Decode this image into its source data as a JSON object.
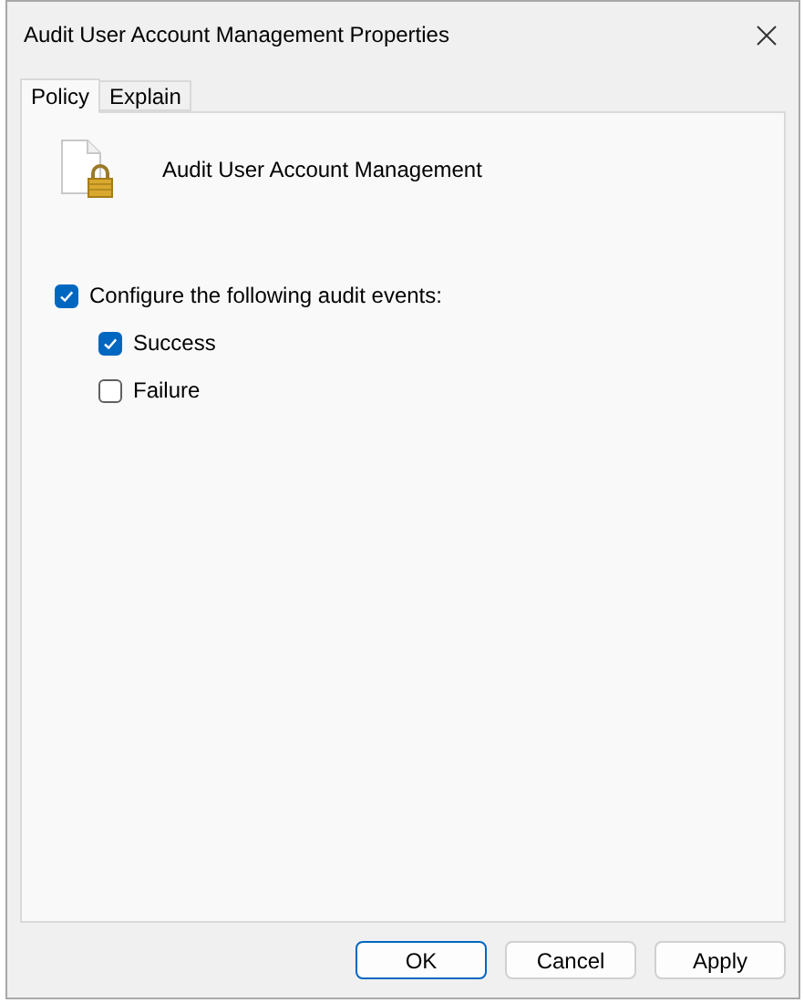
{
  "window": {
    "title": "Audit User Account Management Properties"
  },
  "tabs": [
    {
      "label": "Policy",
      "selected": true
    },
    {
      "label": "Explain",
      "selected": false
    }
  ],
  "policy": {
    "name": "Audit User Account Management"
  },
  "configure": {
    "label": "Configure the following audit events:",
    "checked": true,
    "options": [
      {
        "label": "Success",
        "checked": true
      },
      {
        "label": "Failure",
        "checked": false
      }
    ]
  },
  "buttons": [
    {
      "label": "OK",
      "default": true
    },
    {
      "label": "Cancel",
      "default": false
    },
    {
      "label": "Apply",
      "default": false
    }
  ]
}
